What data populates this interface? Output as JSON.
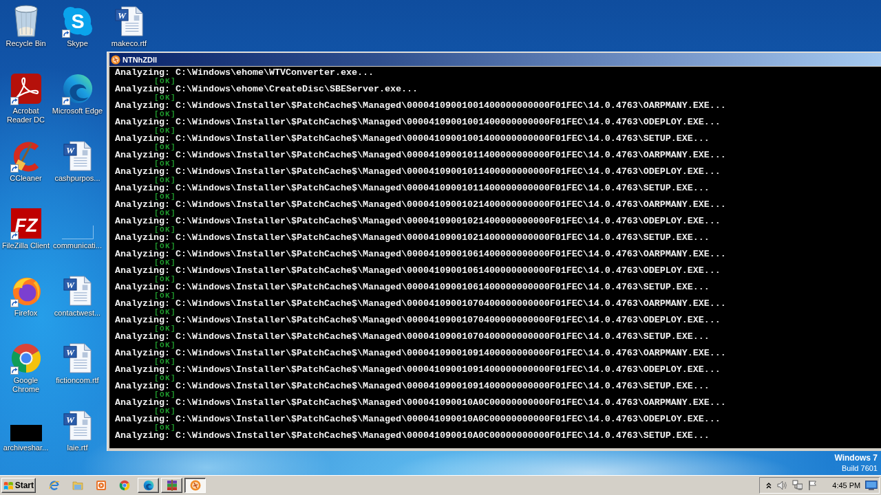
{
  "desktop": {
    "icons": [
      {
        "label": "Recycle Bin",
        "kind": "recycle-bin",
        "shortcut": false
      },
      {
        "label": "Acrobat Reader DC",
        "kind": "acrobat",
        "shortcut": true
      },
      {
        "label": "CCleaner",
        "kind": "ccleaner",
        "shortcut": true
      },
      {
        "label": "FileZilla Client",
        "kind": "filezilla",
        "glyph": "FZ",
        "shortcut": true
      },
      {
        "label": "Firefox",
        "kind": "firefox",
        "shortcut": true
      },
      {
        "label": "Google Chrome",
        "kind": "chrome",
        "shortcut": true
      },
      {
        "label": "archiveshar...",
        "kind": "thumbnail",
        "shortcut": false
      },
      {
        "label": "Skype",
        "kind": "skype",
        "glyph": "S",
        "shortcut": true
      },
      {
        "label": "Microsoft Edge",
        "kind": "edge",
        "shortcut": true
      },
      {
        "label": "cashpurpos...",
        "kind": "word-doc",
        "glyph": "W",
        "shortcut": false
      },
      {
        "label": "communicati...",
        "kind": "blank",
        "shortcut": false
      },
      {
        "label": "contactwest...",
        "kind": "word-doc",
        "glyph": "W",
        "shortcut": false
      },
      {
        "label": "fictioncom.rtf",
        "kind": "word-doc",
        "glyph": "W",
        "shortcut": false
      },
      {
        "label": "laie.rtf",
        "kind": "word-doc",
        "glyph": "W",
        "shortcut": false
      },
      {
        "label": "makeco.rtf",
        "kind": "word-doc",
        "glyph": "W",
        "shortcut": false
      }
    ]
  },
  "window": {
    "title": "NTNhZDll",
    "lines": [
      {
        "kind": "path",
        "text": "Analyzing: C:\\Windows\\ehome\\WTVConverter.exe..."
      },
      {
        "kind": "status",
        "text": "[OK]"
      },
      {
        "kind": "path",
        "text": "Analyzing: C:\\Windows\\ehome\\CreateDisc\\SBEServer.exe..."
      },
      {
        "kind": "status",
        "text": "[OK]"
      },
      {
        "kind": "path",
        "text": "Analyzing: C:\\Windows\\Installer\\$PatchCache$\\Managed\\00004109001001400000000000F01FEC\\14.0.4763\\OARPMANY.EXE..."
      },
      {
        "kind": "status",
        "text": "[OK]"
      },
      {
        "kind": "path",
        "text": "Analyzing: C:\\Windows\\Installer\\$PatchCache$\\Managed\\00004109001001400000000000F01FEC\\14.0.4763\\ODEPLOY.EXE..."
      },
      {
        "kind": "status",
        "text": "[OK]"
      },
      {
        "kind": "path",
        "text": "Analyzing: C:\\Windows\\Installer\\$PatchCache$\\Managed\\00004109001001400000000000F01FEC\\14.0.4763\\SETUP.EXE..."
      },
      {
        "kind": "status",
        "text": "[OK]"
      },
      {
        "kind": "path",
        "text": "Analyzing: C:\\Windows\\Installer\\$PatchCache$\\Managed\\00004109001011400000000000F01FEC\\14.0.4763\\OARPMANY.EXE..."
      },
      {
        "kind": "status",
        "text": "[OK]"
      },
      {
        "kind": "path",
        "text": "Analyzing: C:\\Windows\\Installer\\$PatchCache$\\Managed\\00004109001011400000000000F01FEC\\14.0.4763\\ODEPLOY.EXE..."
      },
      {
        "kind": "status",
        "text": "[OK]"
      },
      {
        "kind": "path",
        "text": "Analyzing: C:\\Windows\\Installer\\$PatchCache$\\Managed\\00004109001011400000000000F01FEC\\14.0.4763\\SETUP.EXE..."
      },
      {
        "kind": "status",
        "text": "[OK]"
      },
      {
        "kind": "path",
        "text": "Analyzing: C:\\Windows\\Installer\\$PatchCache$\\Managed\\00004109001021400000000000F01FEC\\14.0.4763\\OARPMANY.EXE..."
      },
      {
        "kind": "status",
        "text": "[OK]"
      },
      {
        "kind": "path",
        "text": "Analyzing: C:\\Windows\\Installer\\$PatchCache$\\Managed\\00004109001021400000000000F01FEC\\14.0.4763\\ODEPLOY.EXE..."
      },
      {
        "kind": "status",
        "text": "[OK]"
      },
      {
        "kind": "path",
        "text": "Analyzing: C:\\Windows\\Installer\\$PatchCache$\\Managed\\00004109001021400000000000F01FEC\\14.0.4763\\SETUP.EXE..."
      },
      {
        "kind": "status",
        "text": "[OK]"
      },
      {
        "kind": "path",
        "text": "Analyzing: C:\\Windows\\Installer\\$PatchCache$\\Managed\\00004109001061400000000000F01FEC\\14.0.4763\\OARPMANY.EXE..."
      },
      {
        "kind": "status",
        "text": "[OK]"
      },
      {
        "kind": "path",
        "text": "Analyzing: C:\\Windows\\Installer\\$PatchCache$\\Managed\\00004109001061400000000000F01FEC\\14.0.4763\\ODEPLOY.EXE..."
      },
      {
        "kind": "status",
        "text": "[OK]"
      },
      {
        "kind": "path",
        "text": "Analyzing: C:\\Windows\\Installer\\$PatchCache$\\Managed\\00004109001061400000000000F01FEC\\14.0.4763\\SETUP.EXE..."
      },
      {
        "kind": "status",
        "text": "[OK]"
      },
      {
        "kind": "path",
        "text": "Analyzing: C:\\Windows\\Installer\\$PatchCache$\\Managed\\00004109001070400000000000F01FEC\\14.0.4763\\OARPMANY.EXE..."
      },
      {
        "kind": "status",
        "text": "[OK]"
      },
      {
        "kind": "path",
        "text": "Analyzing: C:\\Windows\\Installer\\$PatchCache$\\Managed\\00004109001070400000000000F01FEC\\14.0.4763\\ODEPLOY.EXE..."
      },
      {
        "kind": "status",
        "text": "[OK]"
      },
      {
        "kind": "path",
        "text": "Analyzing: C:\\Windows\\Installer\\$PatchCache$\\Managed\\00004109001070400000000000F01FEC\\14.0.4763\\SETUP.EXE..."
      },
      {
        "kind": "status",
        "text": "[OK]"
      },
      {
        "kind": "path",
        "text": "Analyzing: C:\\Windows\\Installer\\$PatchCache$\\Managed\\00004109001091400000000000F01FEC\\14.0.4763\\OARPMANY.EXE..."
      },
      {
        "kind": "status",
        "text": "[OK]"
      },
      {
        "kind": "path",
        "text": "Analyzing: C:\\Windows\\Installer\\$PatchCache$\\Managed\\00004109001091400000000000F01FEC\\14.0.4763\\ODEPLOY.EXE..."
      },
      {
        "kind": "status",
        "text": "[OK]"
      },
      {
        "kind": "path",
        "text": "Analyzing: C:\\Windows\\Installer\\$PatchCache$\\Managed\\00004109001091400000000000F01FEC\\14.0.4763\\SETUP.EXE..."
      },
      {
        "kind": "status",
        "text": "[OK]"
      },
      {
        "kind": "path",
        "text": "Analyzing: C:\\Windows\\Installer\\$PatchCache$\\Managed\\000041090010A0C00000000000F01FEC\\14.0.4763\\OARPMANY.EXE..."
      },
      {
        "kind": "status",
        "text": "[OK]"
      },
      {
        "kind": "path",
        "text": "Analyzing: C:\\Windows\\Installer\\$PatchCache$\\Managed\\000041090010A0C00000000000F01FEC\\14.0.4763\\ODEPLOY.EXE..."
      },
      {
        "kind": "status",
        "text": "[OK]"
      },
      {
        "kind": "path",
        "text": "Analyzing: C:\\Windows\\Installer\\$PatchCache$\\Managed\\000041090010A0C00000000000F01FEC\\14.0.4763\\SETUP.EXE..."
      }
    ]
  },
  "os_badge": {
    "edition": "Windows 7",
    "build": "Build 7601"
  },
  "taskbar": {
    "start": {
      "label": "Start"
    },
    "quick_launch": [
      {
        "kind": "ie"
      },
      {
        "kind": "folder"
      },
      {
        "kind": "media"
      },
      {
        "kind": "chrome"
      }
    ],
    "tasks": [
      {
        "kind": "edge",
        "selected": false
      },
      {
        "kind": "winrar",
        "selected": false
      },
      {
        "kind": "app",
        "selected": true
      }
    ],
    "tray": {
      "icons": [
        {
          "kind": "chevron"
        },
        {
          "kind": "speaker"
        },
        {
          "kind": "network"
        },
        {
          "kind": "flag"
        }
      ],
      "clock": "4:45 PM"
    },
    "show_desktop": {
      "kind": "monitor"
    }
  }
}
